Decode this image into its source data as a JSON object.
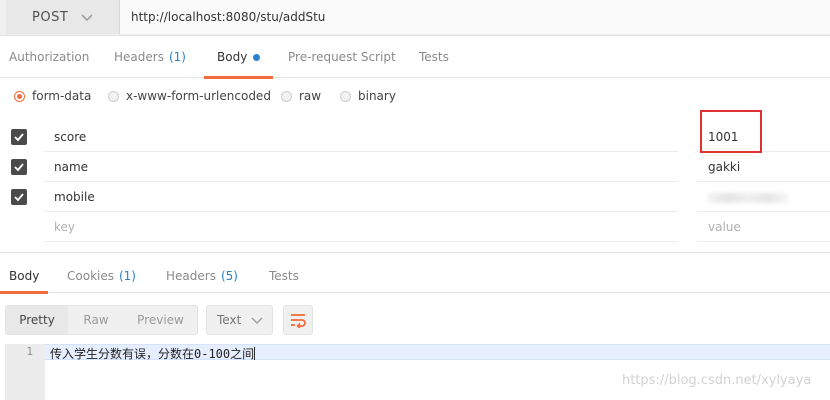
{
  "request": {
    "method": "POST",
    "url": "http://localhost:8080/stu/addStu"
  },
  "request_tabs": [
    {
      "label": "Authorization"
    },
    {
      "label": "Headers",
      "count": "(1)"
    },
    {
      "label": "Body"
    },
    {
      "label": "Pre-request Script"
    },
    {
      "label": "Tests"
    }
  ],
  "body_types": [
    "form-data",
    "x-www-form-urlencoded",
    "raw",
    "binary"
  ],
  "body_type_selected": "form-data",
  "params": [
    {
      "key": "score",
      "value": "1001",
      "checked": true
    },
    {
      "key": "name",
      "value": "gakki",
      "checked": true
    },
    {
      "key": "mobile",
      "value": "",
      "checked": true
    }
  ],
  "new_param": {
    "key_placeholder": "key",
    "value_placeholder": "value"
  },
  "response_tabs": [
    {
      "label": "Body"
    },
    {
      "label": "Cookies",
      "count": "(1)"
    },
    {
      "label": "Headers",
      "count": "(5)"
    },
    {
      "label": "Tests"
    }
  ],
  "view_modes": [
    "Pretty",
    "Raw",
    "Preview"
  ],
  "format_select": "Text",
  "response_body": {
    "line_number": "1",
    "text": "传入学生分数有误，分数在0-100之间"
  },
  "watermark": "https://blog.csdn.net/xylyaya",
  "colors": {
    "accent": "#f26b3a",
    "link": "#2c82c9",
    "highlight_box": "#e03232"
  },
  "icons": [
    "chevron-down-icon",
    "check-icon",
    "wrap-lines-icon"
  ]
}
